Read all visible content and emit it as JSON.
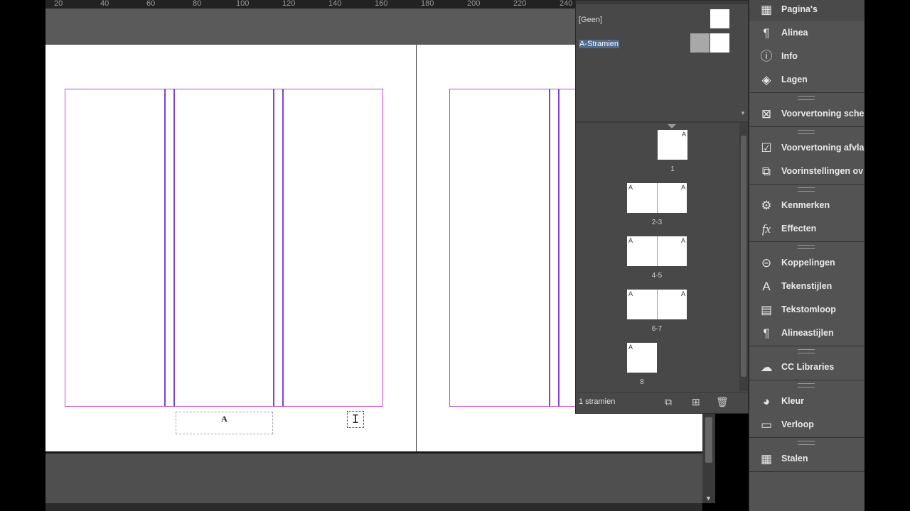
{
  "ruler": {
    "ticks": [
      "20",
      "40",
      "60",
      "80",
      "100",
      "120",
      "140",
      "160",
      "180",
      "200",
      "220",
      "240"
    ]
  },
  "document": {
    "page_number_marker": "A",
    "cursor_glyph": "I"
  },
  "pages_panel": {
    "masters": [
      {
        "label": "[Geen]",
        "selected": false
      },
      {
        "label": "A-Stramien",
        "selected": true
      }
    ],
    "pages": [
      {
        "label": "1",
        "type": "single"
      },
      {
        "label": "2-3",
        "type": "spread"
      },
      {
        "label": "4-5",
        "type": "spread"
      },
      {
        "label": "6-7",
        "type": "spread"
      },
      {
        "label": "8",
        "type": "single"
      }
    ],
    "master_marker": "A",
    "footer_text": "1 stramien"
  },
  "dock": {
    "items": [
      {
        "label": "Pagina's",
        "icon": "pages-icon",
        "glyph": "▦"
      },
      {
        "label": "Alinea",
        "icon": "paragraph-icon",
        "glyph": "¶"
      },
      {
        "label": "Info",
        "icon": "info-icon",
        "glyph": "ⓘ"
      },
      {
        "label": "Lagen",
        "icon": "layers-icon",
        "glyph": "◈"
      },
      {
        "label": "Voorvertoning sche",
        "icon": "separations-preview-icon",
        "glyph": "⊠"
      },
      {
        "label": "Voorvertoning afvla",
        "icon": "flattener-preview-icon",
        "glyph": "☑"
      },
      {
        "label": "Voorinstellingen ov",
        "icon": "presets-icon",
        "glyph": "⧉"
      },
      {
        "label": "Kenmerken",
        "icon": "attributes-icon",
        "glyph": "⚙"
      },
      {
        "label": "Effecten",
        "icon": "effects-icon",
        "glyph": "fx"
      },
      {
        "label": "Koppelingen",
        "icon": "links-icon",
        "glyph": "⊝"
      },
      {
        "label": "Tekenstijlen",
        "icon": "character-styles-icon",
        "glyph": "A"
      },
      {
        "label": "Tekstomloop",
        "icon": "text-wrap-icon",
        "glyph": "▤"
      },
      {
        "label": "Alineastijlen",
        "icon": "paragraph-styles-icon",
        "glyph": "¶"
      },
      {
        "label": "CC Libraries",
        "icon": "cc-libraries-icon",
        "glyph": "☁"
      },
      {
        "label": "Kleur",
        "icon": "color-icon",
        "glyph": "◕"
      },
      {
        "label": "Verloop",
        "icon": "gradient-icon",
        "glyph": "▭"
      },
      {
        "label": "Stalen",
        "icon": "swatches-icon",
        "glyph": "▦"
      }
    ]
  }
}
